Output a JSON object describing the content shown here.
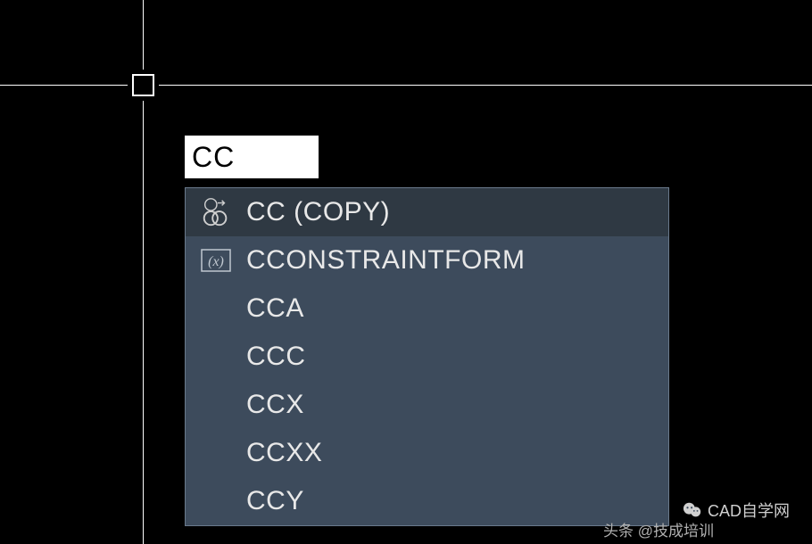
{
  "command_input": {
    "value": "CC"
  },
  "autocomplete": {
    "items": [
      {
        "label": "CC (COPY)",
        "icon": "copy",
        "highlighted": true
      },
      {
        "label": "CCONSTRAINTFORM",
        "icon": "variable",
        "highlighted": false
      },
      {
        "label": "CCA",
        "icon": "none",
        "highlighted": false
      },
      {
        "label": "CCC",
        "icon": "none",
        "highlighted": false
      },
      {
        "label": "CCX",
        "icon": "none",
        "highlighted": false
      },
      {
        "label": "CCXX",
        "icon": "none",
        "highlighted": false
      },
      {
        "label": "CCY",
        "icon": "none",
        "highlighted": false
      }
    ]
  },
  "watermark": {
    "right": "CAD自学网",
    "bottom": "头条 @技成培训"
  }
}
